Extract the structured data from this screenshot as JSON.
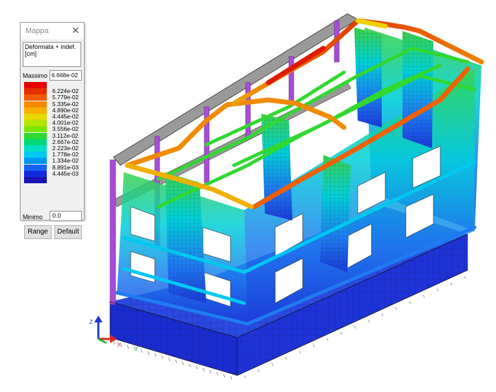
{
  "palette": {
    "title": "Mappa",
    "close_glyph": "✕",
    "type_text": "Deformata + indef. [cm]",
    "max_label": "Massimo",
    "max_value": "6.668e-02",
    "min_label": "Minimo",
    "min_value": "0.0",
    "range_label": "Range",
    "default_label": "Default",
    "scale": [
      {
        "color": "#e60000",
        "label": ""
      },
      {
        "color": "#e62e00",
        "label": "6.224e-02"
      },
      {
        "color": "#f05a00",
        "label": "5.779e-02"
      },
      {
        "color": "#f58a00",
        "label": "5.335e-02"
      },
      {
        "color": "#f5b000",
        "label": "4.890e-02"
      },
      {
        "color": "#e6d800",
        "label": "4.445e-02"
      },
      {
        "color": "#b4e600",
        "label": "4.001e-02"
      },
      {
        "color": "#7ae600",
        "label": "3.556e-02"
      },
      {
        "color": "#30d830",
        "label": "3.112e-02"
      },
      {
        "color": "#00d878",
        "label": "2.667e-02"
      },
      {
        "color": "#00e0c8",
        "label": "2.223e-02"
      },
      {
        "color": "#00c8f0",
        "label": "1.778e-02"
      },
      {
        "color": "#0096f5",
        "label": "1.334e-02"
      },
      {
        "color": "#1464f0",
        "label": "8.891e-03"
      },
      {
        "color": "#1428dc",
        "label": "4.445e-03"
      },
      {
        "color": "#1a14b4",
        "label": ""
      }
    ]
  },
  "axes": {
    "label_x": "X",
    "label_z": "Z",
    "label_y": "Y"
  },
  "colors": {
    "base_blue": "#1a2cd0",
    "purple_column": "#a84cd8",
    "gray_beam": "#9a9a9a",
    "peach_floor": "#e8c8b0"
  }
}
